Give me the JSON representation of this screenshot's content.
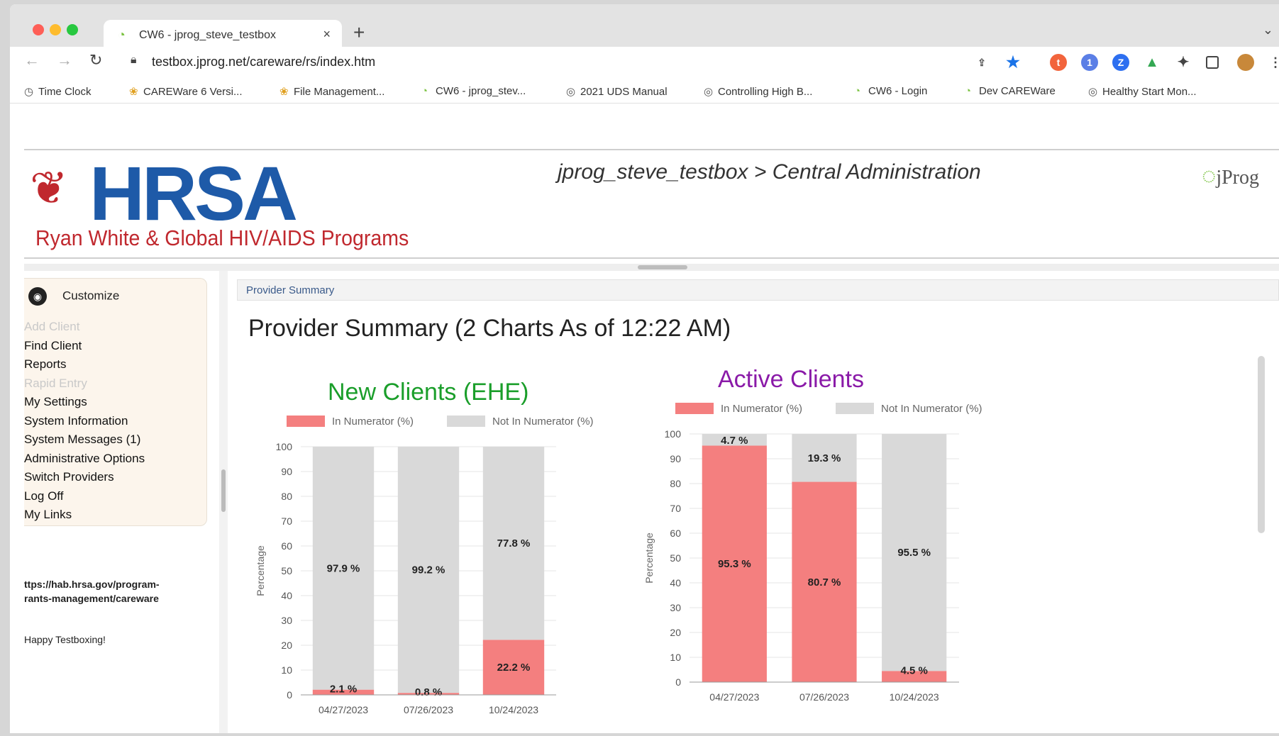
{
  "browser": {
    "tab_title": "CW6 - jprog_steve_testbox",
    "tab_close": "×",
    "new_tab": "+",
    "url": "testbox.jprog.net/careware/rs/index.htm",
    "bookmarks": [
      {
        "label": "Time Clock",
        "icon": "clock-icon"
      },
      {
        "label": "CAREWare 6 Versi...",
        "icon": "careware-icon"
      },
      {
        "label": "File Management...",
        "icon": "careware-icon"
      },
      {
        "label": "CW6 - jprog_stev...",
        "icon": "cw-icon"
      },
      {
        "label": "2021 UDS Manual",
        "icon": "globe-icon"
      },
      {
        "label": "Controlling High B...",
        "icon": "globe-icon"
      },
      {
        "label": "CW6 - Login",
        "icon": "cw-icon"
      },
      {
        "label": "Dev CAREWare",
        "icon": "cw-icon"
      },
      {
        "label": "Healthy Start Mon...",
        "icon": "globe-icon"
      }
    ]
  },
  "header": {
    "logo_word": "HRSA",
    "logo_sub": "Ryan White & Global HIV/AIDS Programs",
    "breadcrumb": "jprog_steve_testbox > Central Administration",
    "jprog_logo": "jProg"
  },
  "sidebar": {
    "customize": "Customize",
    "items": [
      {
        "label": "Add Client",
        "disabled": true
      },
      {
        "label": "Find Client",
        "disabled": false
      },
      {
        "label": "Reports",
        "disabled": false
      },
      {
        "label": "Rapid Entry",
        "disabled": true
      },
      {
        "label": "My Settings",
        "disabled": false
      },
      {
        "label": "System Information",
        "disabled": false
      },
      {
        "label": "System Messages (1)",
        "disabled": false
      },
      {
        "label": "Administrative Options",
        "disabled": false
      },
      {
        "label": "Switch Providers",
        "disabled": false
      },
      {
        "label": "Log Off",
        "disabled": false
      },
      {
        "label": "My Links",
        "disabled": false
      }
    ],
    "link_line1": "ttps://hab.hrsa.gov/program-",
    "link_line2": "rants-management/careware",
    "message": "Happy Testboxing!"
  },
  "main": {
    "tab_label": "Provider Summary",
    "title": "Provider Summary (2 Charts As of 12:22 AM)"
  },
  "colors": {
    "in_numerator": "#f47f7f",
    "not_in_numerator": "#d9d9d9",
    "new_clients_title": "#1a9e2a",
    "active_clients_title": "#8a1aa8"
  },
  "chart_data": [
    {
      "type": "bar",
      "stacked": true,
      "title": "New Clients (EHE)",
      "ylabel": "Percentage",
      "ylim": [
        0,
        100
      ],
      "yticks": [
        0,
        10,
        20,
        30,
        40,
        50,
        60,
        70,
        80,
        90,
        100
      ],
      "categories": [
        "04/27/2023",
        "07/26/2023",
        "10/24/2023"
      ],
      "series": [
        {
          "name": "In Numerator (%)",
          "values": [
            2.1,
            0.8,
            22.2
          ],
          "labels": [
            "2.1 %",
            "0.8 %",
            "22.2 %"
          ]
        },
        {
          "name": "Not In Numerator (%)",
          "values": [
            97.9,
            99.2,
            77.8
          ],
          "labels": [
            "97.9 %",
            "99.2 %",
            "77.8 %"
          ]
        }
      ],
      "legend": "top",
      "grid": true
    },
    {
      "type": "bar",
      "stacked": true,
      "title": "Active Clients",
      "ylabel": "Percentage",
      "ylim": [
        0,
        100
      ],
      "yticks": [
        0,
        10,
        20,
        30,
        40,
        50,
        60,
        70,
        80,
        90,
        100
      ],
      "categories": [
        "04/27/2023",
        "07/26/2023",
        "10/24/2023"
      ],
      "series": [
        {
          "name": "In Numerator (%)",
          "values": [
            95.3,
            80.7,
            4.5
          ],
          "labels": [
            "95.3 %",
            "80.7 %",
            "4.5 %"
          ]
        },
        {
          "name": "Not In Numerator (%)",
          "values": [
            4.7,
            19.3,
            95.5
          ],
          "labels": [
            "4.7 %",
            "19.3 %",
            "95.5 %"
          ]
        }
      ],
      "legend": "top",
      "grid": true
    }
  ]
}
